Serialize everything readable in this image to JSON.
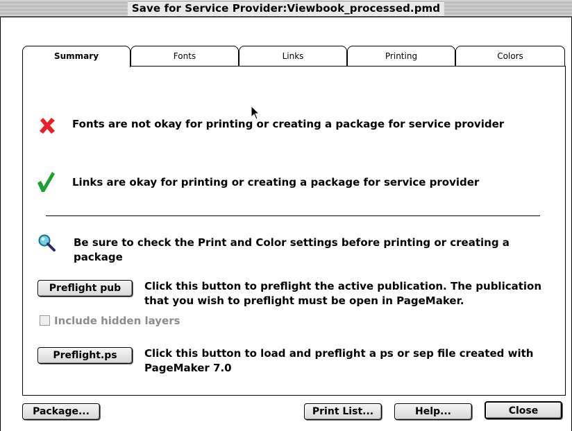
{
  "window": {
    "title": "Save for Service Provider:Viewbook_processed.pmd"
  },
  "tabs": [
    {
      "label": "Summary",
      "active": true
    },
    {
      "label": "Fonts",
      "active": false
    },
    {
      "label": "Links",
      "active": false
    },
    {
      "label": "Printing",
      "active": false
    },
    {
      "label": "Colors",
      "active": false
    }
  ],
  "summary": {
    "fonts_status": {
      "icon": "red-x-icon",
      "text": "Fonts are not okay for printing or creating a package for service provider",
      "color": "#e8202a"
    },
    "links_status": {
      "icon": "green-check-icon",
      "text": "Links are okay for printing or creating a package for service provider",
      "color": "#1aa033"
    },
    "note": {
      "icon": "magnifier-icon",
      "text": "Be sure to check the Print and Color settings before printing or creating a package"
    },
    "preflight_pub": {
      "label": "Preflight pub",
      "description": "Click this button to preflight the active publication. The publication that you wish to preflight must be open in PageMaker."
    },
    "include_hidden_layers": {
      "label": "Include hidden layers",
      "checked": false,
      "enabled": false
    },
    "preflight_ps": {
      "label": "Preflight.ps",
      "description": "Click this button to load and preflight a ps or sep file created with PageMaker 7.0"
    }
  },
  "footer": {
    "package_label": "Package...",
    "print_list_label": "Print List...",
    "help_label": "Help...",
    "close_label": "Close"
  }
}
